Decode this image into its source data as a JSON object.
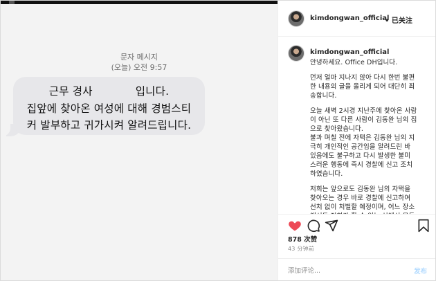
{
  "photo": {
    "header_title": "문자 메시지",
    "header_date": "(오늘) 오전 9:57",
    "bubble": {
      "line1_left": "근무 경사",
      "line1_right": "입니다.",
      "line2": "집앞에 찾아온 여성에 대해 경범스티",
      "line3": "커 발부하고 귀가시켜 알려드립니다."
    },
    "bubble_color": "#e7e7ea"
  },
  "sidebar": {
    "username": "kimdongwan_official",
    "follow_label": "• 已关注",
    "caption_lines": [
      "안녕하세요. Office DH입니다.",
      "",
      "먼저 얼마 지나지 않아 다시 한번 불편",
      "한 내용의 글을 올리게 되어 대단히 죄",
      "송합니다.",
      "",
      "오늘 새벽 2시경 지난주에 찾아온 사람",
      "이 아닌 또 다른 사람이 김동완 님의 집",
      "으로 찾아왔습니다.",
      "불과 며칠 전에 자택은 김동완 님의 지",
      "극히 개인적인 공간임을 알려드린 바",
      "있음에도 불구하고 다시 발생한 불미",
      "스러운 행동에 즉시 경찰에 신고 조치",
      "하였습니다.",
      "",
      "저희는 앞으로도 김동완 님의 자택을",
      "찾아오는 경우 바로 경찰에 신고하여",
      "선처 없이 처벌할 예정이며, 어느 장소",
      "에서도 저희가 할 수 있는 선에서 모든"
    ],
    "actions": {
      "like_icon": "heart-icon",
      "comment_icon": "comment-icon",
      "share_icon": "share-icon",
      "save_icon": "bookmark-icon",
      "like_color": "#ed4956"
    },
    "likes_text": "878 次赞",
    "time_text": "43 分钟前",
    "comment_placeholder": "添加评论...",
    "post_label": "发布"
  }
}
